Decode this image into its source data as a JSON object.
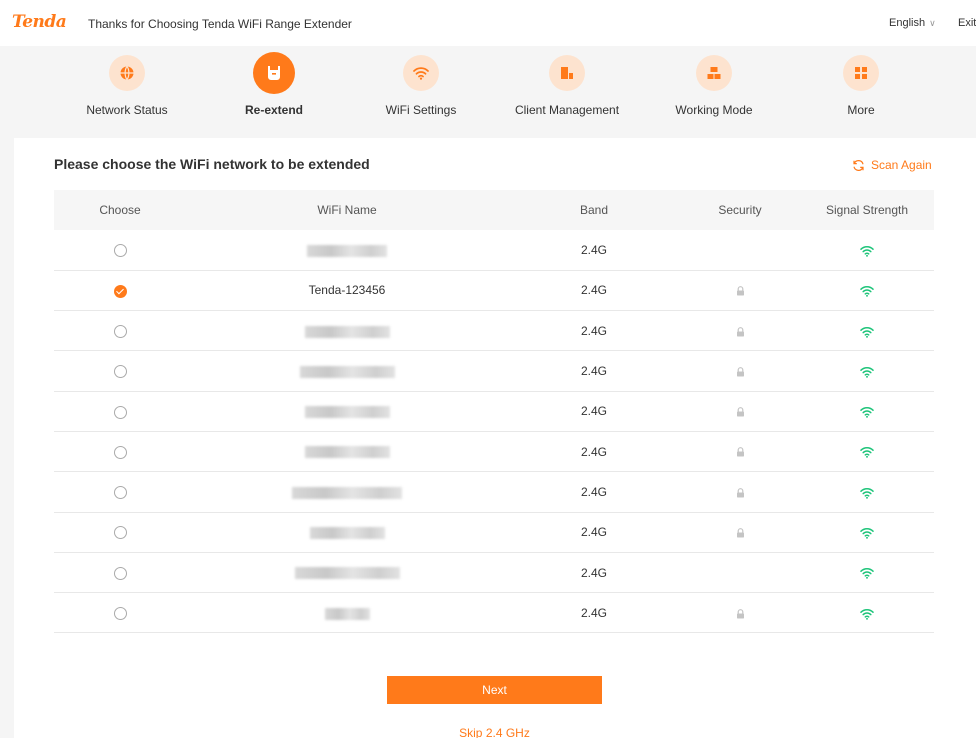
{
  "header": {
    "logo": "Tenda",
    "tagline": "Thanks for Choosing Tenda WiFi Range Extender",
    "language": "English",
    "exit": "Exit"
  },
  "nav": [
    {
      "label": "Network Status",
      "icon": "globe-icon",
      "active": false
    },
    {
      "label": "Re-extend",
      "icon": "extender-icon",
      "active": true
    },
    {
      "label": "WiFi Settings",
      "icon": "wifi-icon",
      "active": false
    },
    {
      "label": "Client Management",
      "icon": "clients-icon",
      "active": false
    },
    {
      "label": "Working Mode",
      "icon": "mode-icon",
      "active": false
    },
    {
      "label": "More",
      "icon": "grid-icon",
      "active": false
    }
  ],
  "main": {
    "heading": "Please choose the WiFi network to be extended",
    "scan_again": "Scan Again",
    "columns": [
      "Choose",
      "WiFi Name",
      "Band",
      "Security",
      "Signal Strength"
    ],
    "rows": [
      {
        "name": "",
        "band": "2.4G",
        "secured": false,
        "selected": false
      },
      {
        "name": "Tenda-123456",
        "band": "2.4G",
        "secured": true,
        "selected": true
      },
      {
        "name": "",
        "band": "2.4G",
        "secured": true,
        "selected": false
      },
      {
        "name": "",
        "band": "2.4G",
        "secured": true,
        "selected": false
      },
      {
        "name": "",
        "band": "2.4G",
        "secured": true,
        "selected": false
      },
      {
        "name": "",
        "band": "2.4G",
        "secured": true,
        "selected": false
      },
      {
        "name": "",
        "band": "2.4G",
        "secured": true,
        "selected": false
      },
      {
        "name": "",
        "band": "2.4G",
        "secured": true,
        "selected": false
      },
      {
        "name": "",
        "band": "2.4G",
        "secured": false,
        "selected": false
      },
      {
        "name": "",
        "band": "2.4G",
        "secured": true,
        "selected": false
      }
    ],
    "next_label": "Next",
    "skip_label": "Skip 2.4 GHz"
  },
  "colors": {
    "accent": "#ff7a1a",
    "signal": "#1ec47a",
    "accent_light": "#fde3cf"
  }
}
